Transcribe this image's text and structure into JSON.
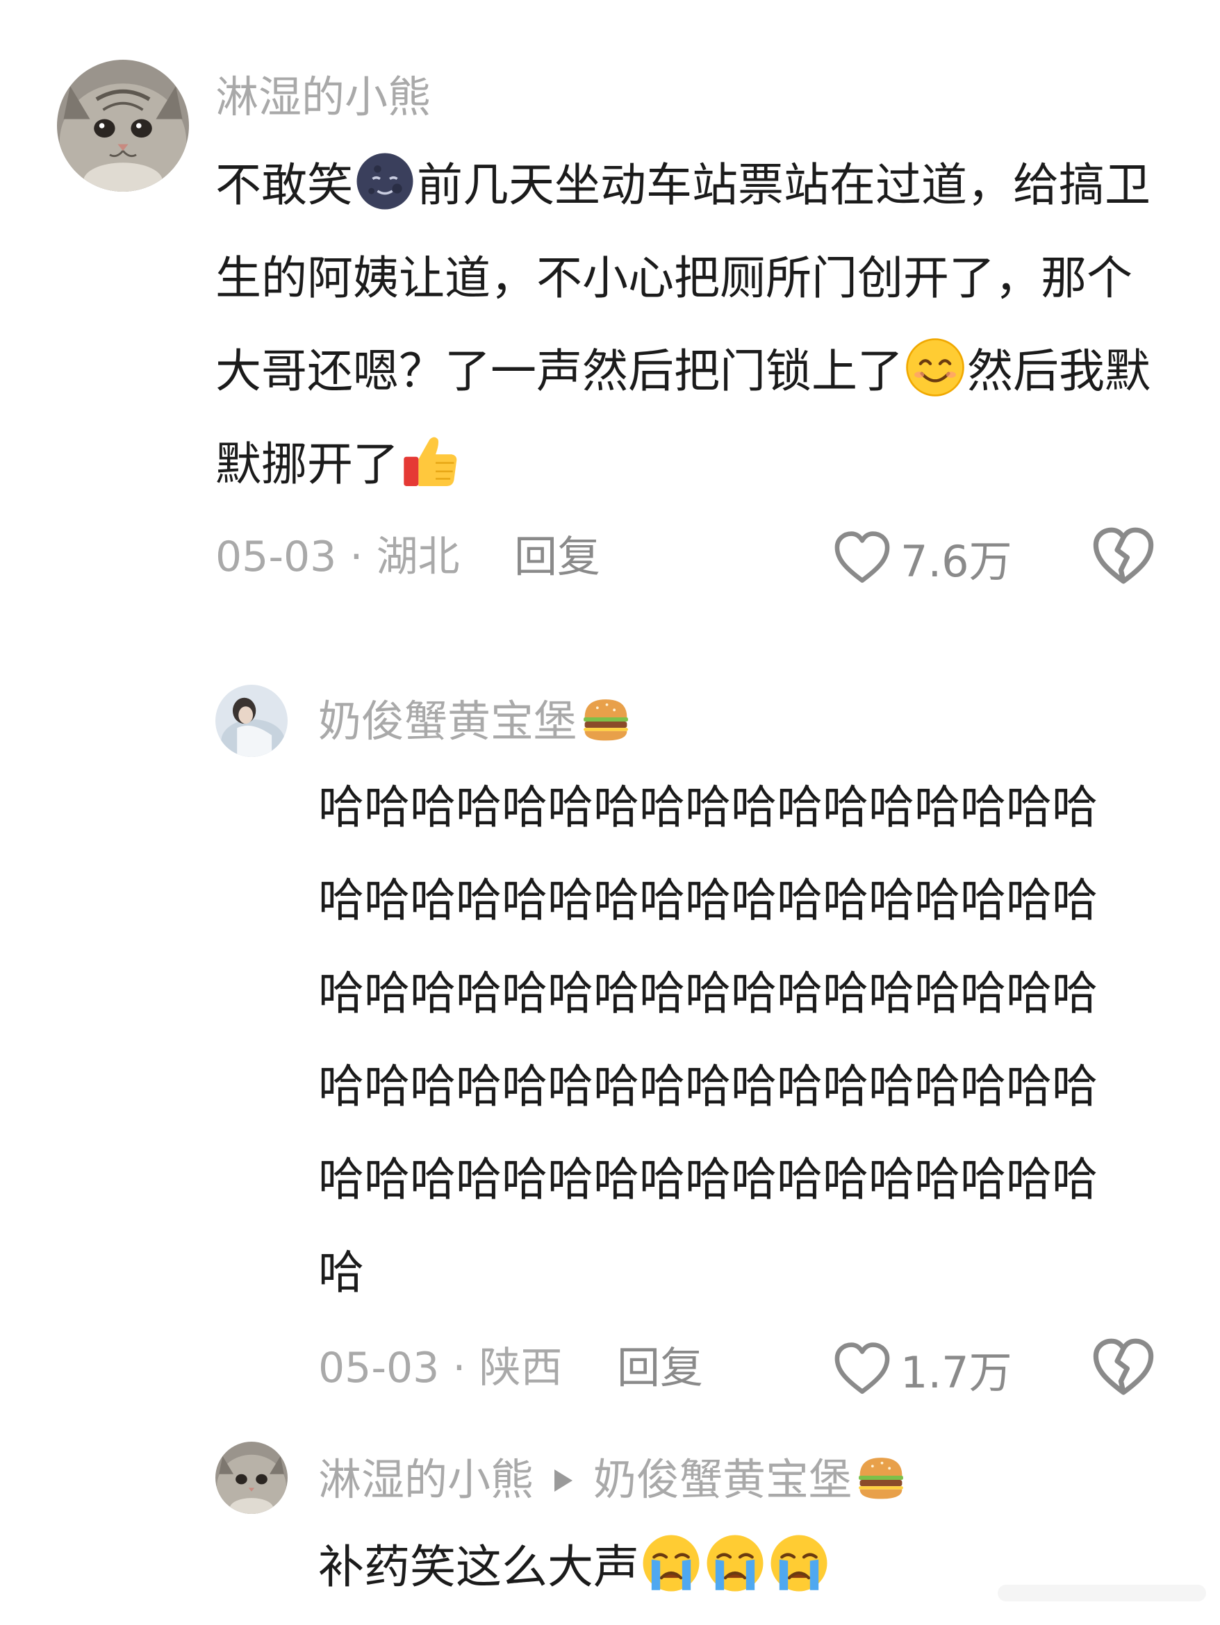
{
  "comment": {
    "username": "淋湿的小熊",
    "text_parts": [
      "不敢笑",
      "前几天坐动车站票站在过道，给搞卫生的阿姨让道，不小心把厕所门创开了，那个大哥还嗯？了一声然后把门锁上了",
      "然后我默默挪开了"
    ],
    "date_location": "05-03 · 湖北",
    "reply_label": "回复",
    "likes": "7.6万"
  },
  "reply1": {
    "username": "奶俊蟹黄宝堡",
    "text": "哈哈哈哈哈哈哈哈哈哈哈哈哈哈哈哈哈哈哈哈哈哈哈哈哈哈哈哈哈哈哈哈哈哈哈哈哈哈哈哈哈哈哈哈哈哈哈哈哈哈哈哈哈哈哈哈哈哈哈哈哈哈哈哈哈哈哈哈哈哈哈哈哈哈哈哈哈哈哈哈哈哈哈哈哈哈",
    "date_location": "05-03 · 陕西",
    "reply_label": "回复",
    "likes": "1.7万"
  },
  "reply2": {
    "username": "淋湿的小熊",
    "reply_to": "奶俊蟹黄宝堡",
    "text": "补药笑这么大声"
  },
  "colors": {
    "text": "#1b1b1b",
    "muted": "#a9a9a9",
    "action": "#8a8a8a"
  }
}
